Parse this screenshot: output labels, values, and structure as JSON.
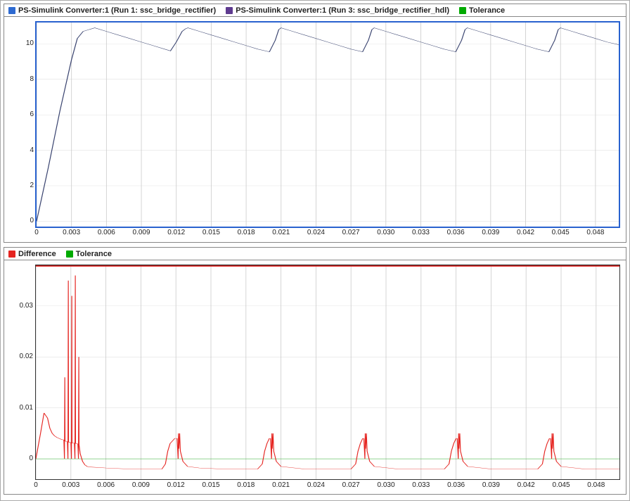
{
  "chart_data": [
    {
      "type": "line",
      "x": [
        0,
        0.001,
        0.002,
        0.003,
        0.0035,
        0.004,
        0.005,
        0.006,
        0.007,
        0.008,
        0.009,
        0.01,
        0.011,
        0.0115,
        0.012,
        0.0125,
        0.0128,
        0.013,
        0.014,
        0.015,
        0.016,
        0.017,
        0.018,
        0.019,
        0.02,
        0.0205,
        0.0208,
        0.021,
        0.022,
        0.023,
        0.024,
        0.025,
        0.026,
        0.027,
        0.028,
        0.0285,
        0.0288,
        0.029,
        0.03,
        0.031,
        0.032,
        0.033,
        0.034,
        0.035,
        0.036,
        0.0365,
        0.0368,
        0.037,
        0.038,
        0.039,
        0.04,
        0.041,
        0.042,
        0.043,
        0.044,
        0.0445,
        0.0448,
        0.045,
        0.046,
        0.047,
        0.048,
        0.049,
        0.05
      ],
      "series": [
        {
          "name": "PS-Simulink Converter:1 (Run 1: ssc_bridge_rectifier)",
          "color": "#2e6ad1",
          "values": [
            0.0,
            3.0,
            6.2,
            9.1,
            10.3,
            10.7,
            10.9,
            10.7,
            10.5,
            10.3,
            10.1,
            9.9,
            9.7,
            9.6,
            10.1,
            10.7,
            10.85,
            10.9,
            10.7,
            10.5,
            10.3,
            10.1,
            9.9,
            9.7,
            9.55,
            10.2,
            10.8,
            10.9,
            10.7,
            10.5,
            10.3,
            10.1,
            9.9,
            9.7,
            9.55,
            10.2,
            10.8,
            10.9,
            10.7,
            10.5,
            10.3,
            10.1,
            9.9,
            9.7,
            9.55,
            10.2,
            10.8,
            10.9,
            10.7,
            10.5,
            10.3,
            10.1,
            9.9,
            9.7,
            9.55,
            10.2,
            10.8,
            10.9,
            10.7,
            10.5,
            10.3,
            10.1,
            9.95
          ]
        },
        {
          "name": "PS-Simulink Converter:1 (Run 3: ssc_bridge_rectifier_hdl)",
          "color": "#5e3a8f",
          "values": [
            0.0,
            3.0,
            6.2,
            9.1,
            10.3,
            10.7,
            10.9,
            10.7,
            10.5,
            10.3,
            10.1,
            9.9,
            9.7,
            9.6,
            10.1,
            10.7,
            10.85,
            10.9,
            10.7,
            10.5,
            10.3,
            10.1,
            9.9,
            9.7,
            9.55,
            10.2,
            10.8,
            10.9,
            10.7,
            10.5,
            10.3,
            10.1,
            9.9,
            9.7,
            9.55,
            10.2,
            10.8,
            10.9,
            10.7,
            10.5,
            10.3,
            10.1,
            9.9,
            9.7,
            9.55,
            10.2,
            10.8,
            10.9,
            10.7,
            10.5,
            10.3,
            10.1,
            9.9,
            9.7,
            9.55,
            10.2,
            10.8,
            10.9,
            10.7,
            10.5,
            10.3,
            10.1,
            9.95
          ]
        },
        {
          "name": "Tolerance",
          "color": "#00aa00",
          "values": null
        }
      ],
      "yticks": [
        0,
        2,
        4,
        6,
        8,
        10
      ],
      "xticks": [
        0,
        0.003,
        0.006,
        0.009,
        0.012,
        0.015,
        0.018,
        0.021,
        0.024,
        0.027,
        0.03,
        0.033,
        0.036,
        0.039,
        0.042,
        0.045,
        0.048
      ],
      "xlim": [
        0,
        0.05
      ],
      "ylim": [
        -0.3,
        11.2
      ],
      "legend": [
        {
          "color": "#2e6ad1",
          "label": "PS-Simulink Converter:1 (Run 1: ssc_bridge_rectifier)"
        },
        {
          "color": "#5e3a8f",
          "label": "PS-Simulink Converter:1 (Run 3: ssc_bridge_rectifier_hdl)"
        },
        {
          "color": "#00aa00",
          "label": "Tolerance"
        }
      ]
    },
    {
      "type": "line",
      "x": [
        0,
        0.0004,
        0.0007,
        0.001,
        0.0012,
        0.0014,
        0.0016,
        0.0018,
        0.002,
        0.0022,
        0.0024,
        0.00245,
        0.00248,
        0.0025,
        0.0026,
        0.0027,
        0.00275,
        0.00278,
        0.0028,
        0.0029,
        0.003,
        0.00305,
        0.00308,
        0.0031,
        0.0032,
        0.0033,
        0.00335,
        0.00338,
        0.0034,
        0.0035,
        0.0036,
        0.00365,
        0.00368,
        0.0037,
        0.0038,
        0.004,
        0.0042,
        0.0044,
        0.0046,
        0.006,
        0.008,
        0.01,
        0.0108,
        0.0111,
        0.0113,
        0.0115,
        0.0117,
        0.0119,
        0.0121,
        0.01219,
        0.01222,
        0.01225,
        0.01232,
        0.01238,
        0.0126,
        0.013,
        0.014,
        0.016,
        0.018,
        0.019,
        0.0194,
        0.0196,
        0.0198,
        0.02,
        0.0201,
        0.02019,
        0.02022,
        0.02025,
        0.02032,
        0.02038,
        0.0206,
        0.021,
        0.023,
        0.025,
        0.027,
        0.0274,
        0.0276,
        0.0278,
        0.028,
        0.0281,
        0.02819,
        0.02822,
        0.02825,
        0.02832,
        0.02838,
        0.0286,
        0.029,
        0.031,
        0.033,
        0.035,
        0.0354,
        0.0356,
        0.0358,
        0.036,
        0.0361,
        0.03619,
        0.03622,
        0.03625,
        0.03632,
        0.03638,
        0.0366,
        0.037,
        0.039,
        0.041,
        0.043,
        0.0434,
        0.0436,
        0.0438,
        0.044,
        0.0441,
        0.04419,
        0.04422,
        0.04425,
        0.04432,
        0.04438,
        0.0446,
        0.045,
        0.047,
        0.049,
        0.05
      ],
      "series": [
        {
          "name": "Difference",
          "color": "#e52420",
          "values": [
            0.0,
            0.005,
            0.009,
            0.008,
            0.006,
            0.005,
            0.0045,
            0.0042,
            0.004,
            0.0038,
            0.0037,
            0.0,
            0.016,
            0.0035,
            0.0034,
            0.0034,
            0.0,
            0.035,
            0.0033,
            0.0032,
            0.0032,
            0.0,
            0.032,
            0.0031,
            0.0031,
            0.0031,
            0.0,
            0.036,
            0.003,
            0.003,
            0.0029,
            0.0,
            0.02,
            0.0028,
            0.001,
            -0.0005,
            -0.0012,
            -0.0015,
            -0.0016,
            -0.0018,
            -0.002,
            -0.002,
            -0.002,
            -0.001,
            0.0015,
            0.003,
            0.0035,
            0.004,
            0.004,
            0.0,
            0.005,
            0.002,
            0.005,
            0.0015,
            -0.0005,
            -0.0015,
            -0.0018,
            -0.002,
            -0.002,
            -0.002,
            -0.001,
            0.0015,
            0.003,
            0.004,
            0.004,
            0.0,
            0.005,
            0.002,
            0.005,
            0.0015,
            -0.0005,
            -0.0015,
            -0.002,
            -0.002,
            -0.002,
            -0.001,
            0.0015,
            0.003,
            0.004,
            0.004,
            0.0,
            0.005,
            0.002,
            0.005,
            0.0015,
            -0.0005,
            -0.0015,
            -0.002,
            -0.002,
            -0.002,
            -0.001,
            0.0015,
            0.003,
            0.004,
            0.004,
            0.0,
            0.005,
            0.002,
            0.005,
            0.0015,
            -0.0005,
            -0.0015,
            -0.002,
            -0.002,
            -0.002,
            -0.001,
            0.0015,
            0.003,
            0.004,
            0.004,
            0.0,
            0.005,
            0.002,
            0.005,
            0.0015,
            -0.0005,
            -0.0015,
            -0.002,
            -0.002,
            -0.002
          ]
        },
        {
          "name": "Tolerance",
          "color": "#00aa00",
          "tolerance_value": 0.0
        }
      ],
      "yticks": [
        0,
        0.01,
        0.02,
        0.03
      ],
      "xticks": [
        0,
        0.003,
        0.006,
        0.009,
        0.012,
        0.015,
        0.018,
        0.021,
        0.024,
        0.027,
        0.03,
        0.033,
        0.036,
        0.039,
        0.042,
        0.045,
        0.048
      ],
      "xlim": [
        0,
        0.05
      ],
      "ylim": [
        -0.004,
        0.038
      ],
      "legend": [
        {
          "color": "#e52420",
          "label": "Difference"
        },
        {
          "color": "#00aa00",
          "label": "Tolerance"
        }
      ]
    }
  ],
  "colors": {
    "blueFrame": "#2962cf",
    "grid": "#cccccc",
    "signal": "#3a4470",
    "difference": "#e52420",
    "tolerance": "#00aa00",
    "run1": "#2e6ad1",
    "run3": "#5e3a8f"
  }
}
